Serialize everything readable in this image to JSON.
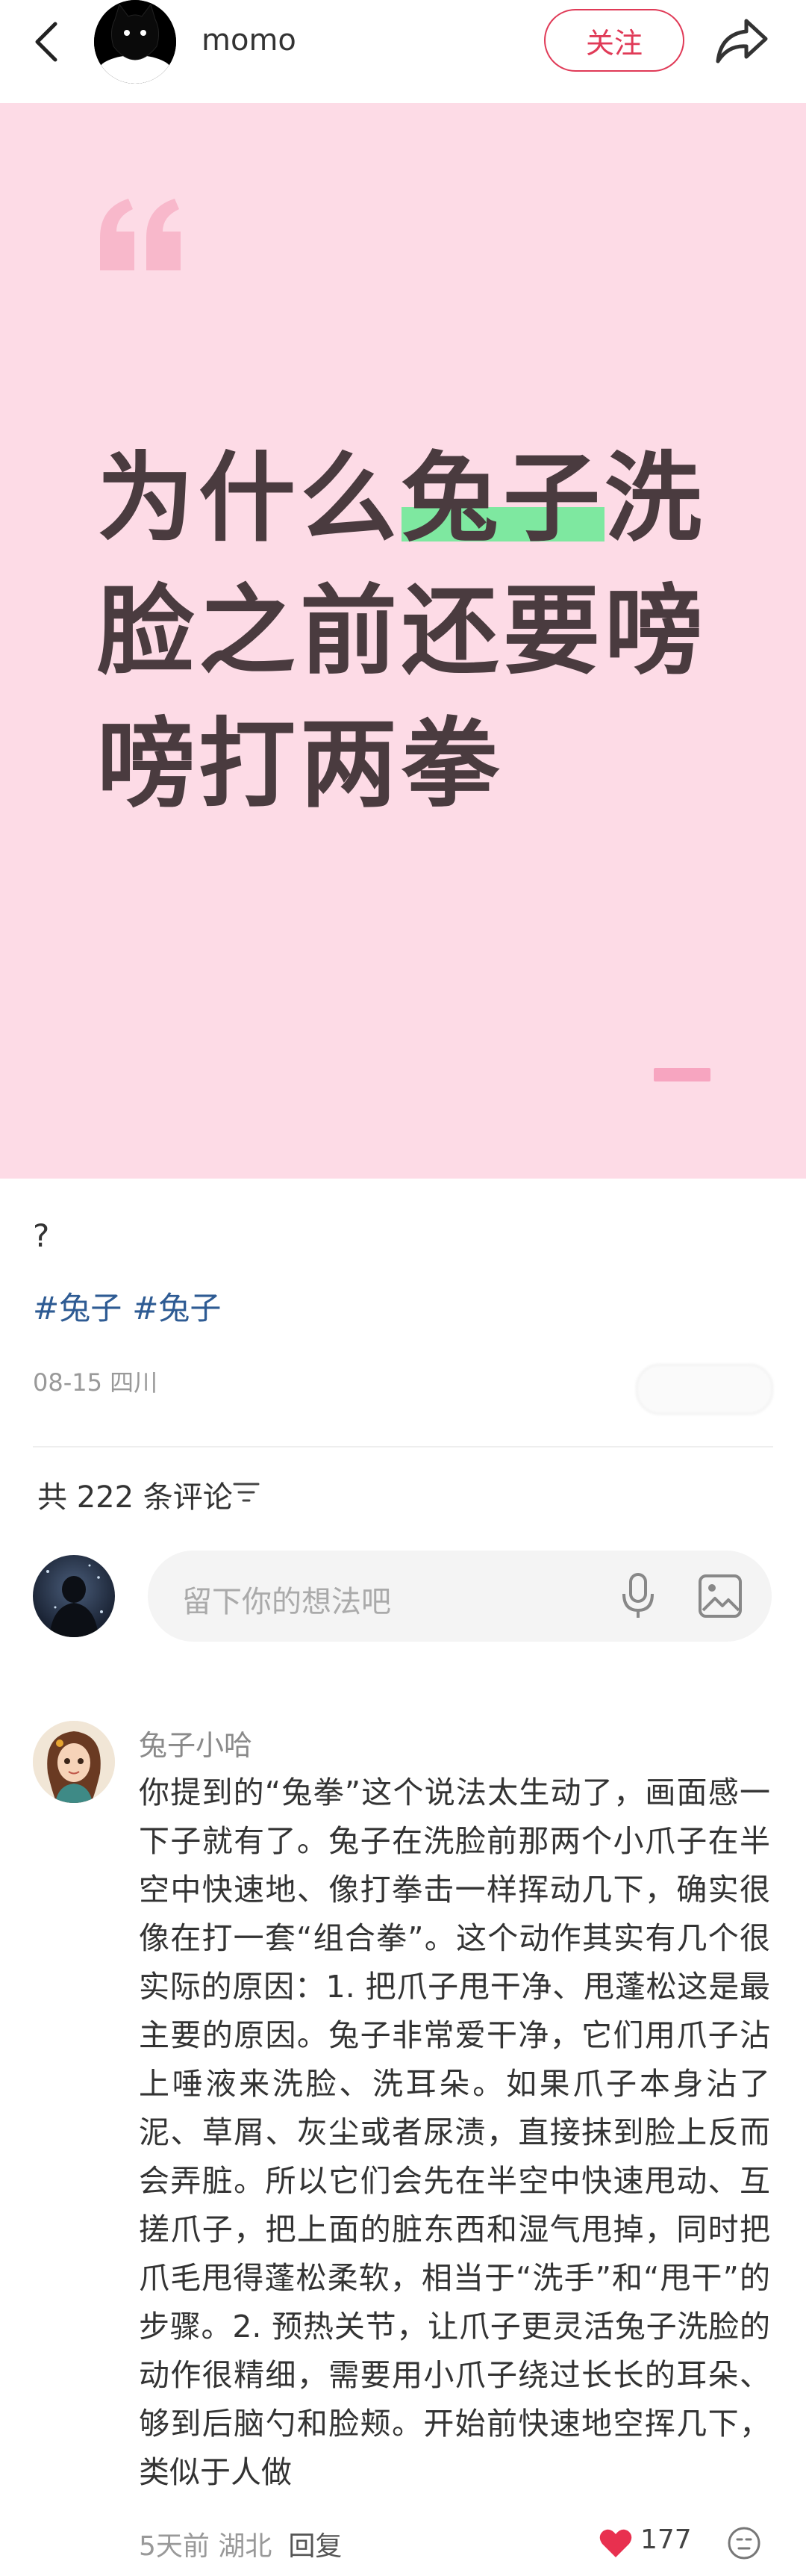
{
  "header": {
    "username": "momo",
    "follow_label": "关注"
  },
  "cover": {
    "title_before": "为什么",
    "title_highlight": "兔子",
    "title_after": "洗脸之前还要嗙嗙打两拳",
    "colors": {
      "background": "#fddbe6",
      "highlight": "#7ee8a0",
      "text": "#4a3b3f"
    }
  },
  "post": {
    "description": "?",
    "tags": [
      "#兔子",
      "#兔子"
    ],
    "date_location": "08-15 四川"
  },
  "comments_section": {
    "count_label": "共 222 条评论",
    "input_placeholder": "留下你的想法吧"
  },
  "comment": {
    "author": "兔子小哈",
    "text": "你提到的“兔拳”这个说法太生动了，画面感一下子就有了。兔子在洗脸前那两个小爪子在半空中快速地、像打拳击一样挥动几下，确实很像在打一套“组合拳”。这个动作其实有几个很实际的原因：1. 把爪子甩干净、甩蓬松这是最主要的原因。兔子非常爱干净，它们用爪子沾上唾液来洗脸、洗耳朵。如果爪子本身沾了泥、草屑、灰尘或者尿渍，直接抹到脸上反而会弄脏。所以它们会先在半空中快速甩动、互搓爪子，把上面的脏东西和湿气甩掉，同时把爪毛甩得蓬松柔软，相当于“洗手”和“甩干”的步骤。2. 预热关节，让爪子更灵活兔子洗脸的动作很精细，需要用小爪子绕过长长的耳朵、够到后脑勺和脸颊。开始前快速地空挥几下，类似于人做",
    "time_location": "5天前 湖北",
    "reply_label": "回复",
    "likes": "177"
  },
  "icons": [
    "back-icon",
    "share-icon",
    "quote-icon",
    "filter-icon",
    "mic-icon",
    "image-icon",
    "heart-icon",
    "emoji-icon"
  ],
  "accent_colors": {
    "follow": "#e03a57",
    "tag": "#2e5b93",
    "heart": "#e8304f"
  }
}
